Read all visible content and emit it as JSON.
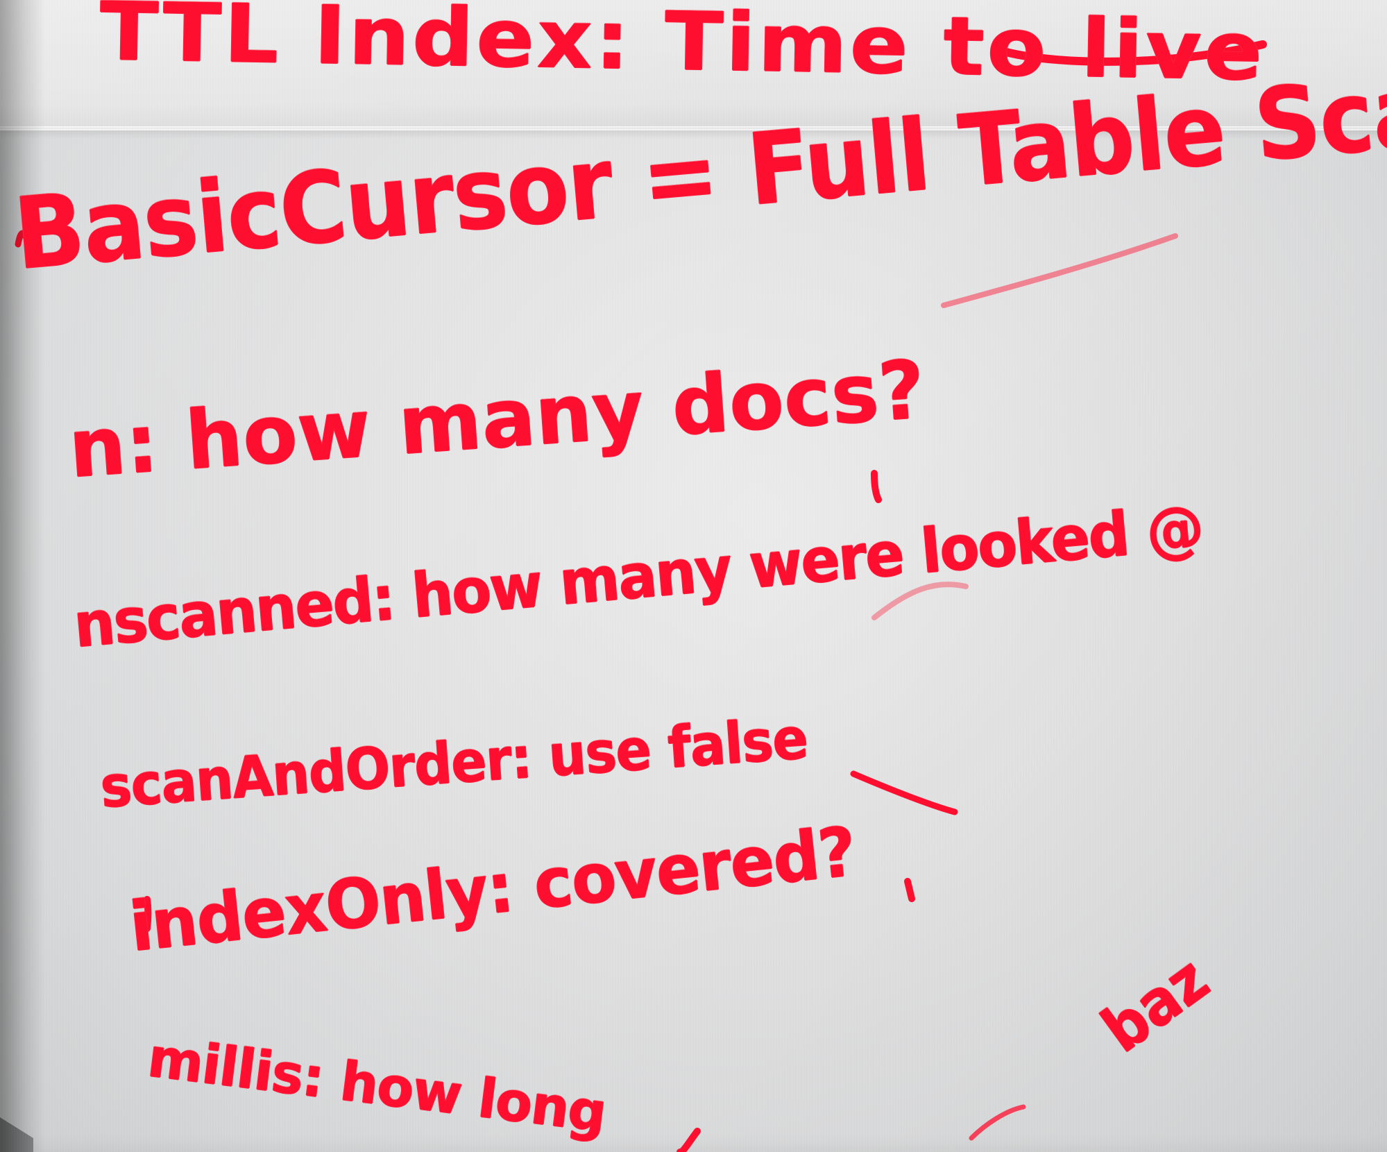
{
  "image": {
    "scene": "photo of handwritten notes on a flip chart",
    "colors": {
      "ink": "#ff0f2f",
      "paper": "#e3e3e4",
      "shadow": "#7b7c7d"
    },
    "notes": {
      "ttl_index": "TTL Index: Time to live",
      "basic_cursor": "BasicCursor = Full Table Scan",
      "n": "n: how many docs?",
      "nscanned": "nscanned: how many were looked @",
      "scan_and_order": "scanAndOrder: use false",
      "index_only": "indexOnly: covered?",
      "millis": "millis: how long",
      "baz": "baz"
    }
  }
}
